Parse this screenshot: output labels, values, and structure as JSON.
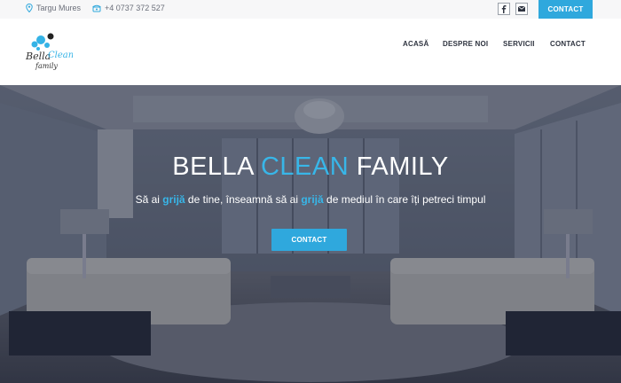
{
  "topbar": {
    "location": "Targu Mures",
    "phone": "+4 0737 372 527",
    "contact_label": "CONTACT",
    "social": [
      "facebook-icon",
      "email-icon"
    ]
  },
  "header": {
    "logo_text": "Bella Clean Family",
    "nav": {
      "home": "ACASĂ",
      "about": "DESPRE NOI",
      "services": "SERVICII",
      "contact": "CONTACT"
    }
  },
  "hero": {
    "title_part1": "BELLA ",
    "title_accent": "CLEAN",
    "title_part2": " FAMILY",
    "subtitle_part1": "Să ai ",
    "subtitle_accent1": "grijă",
    "subtitle_part2": " de tine, înseamnă să ai ",
    "subtitle_accent2": "grijă",
    "subtitle_part3": " de mediul în care îți petreci timpul",
    "button_label": "CONTACT"
  },
  "colors": {
    "accent": "#2fa8dd",
    "topbar_bg": "#f7f7f8",
    "text_dark": "#2f3440"
  }
}
